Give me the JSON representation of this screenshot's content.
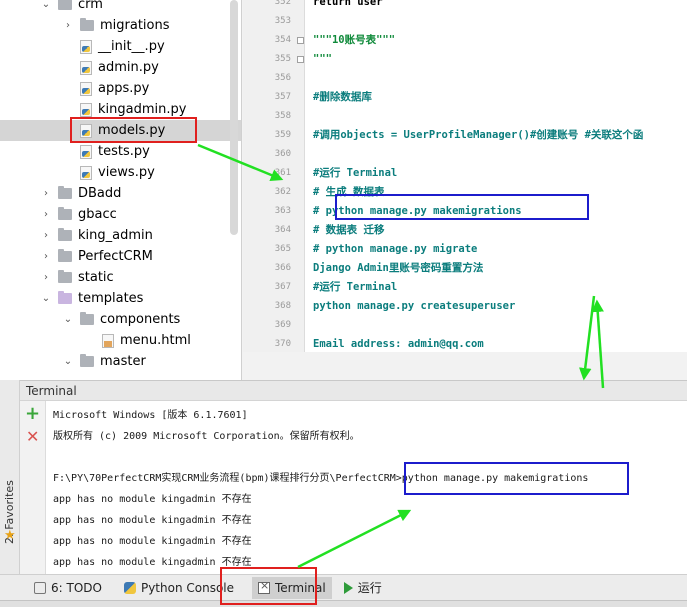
{
  "tree": {
    "items": [
      {
        "label": "crm",
        "kind": "folder",
        "arrow": "⌄",
        "level": 1
      },
      {
        "label": "migrations",
        "kind": "folder",
        "arrow": "›",
        "level": 2
      },
      {
        "label": "__init__.py",
        "kind": "py",
        "arrow": "",
        "level": 2
      },
      {
        "label": "admin.py",
        "kind": "py",
        "arrow": "",
        "level": 2
      },
      {
        "label": "apps.py",
        "kind": "py",
        "arrow": "",
        "level": 2
      },
      {
        "label": "kingadmin.py",
        "kind": "py",
        "arrow": "",
        "level": 2
      },
      {
        "label": "models.py",
        "kind": "py",
        "arrow": "",
        "level": 2,
        "selected": true
      },
      {
        "label": "tests.py",
        "kind": "py",
        "arrow": "",
        "level": 2
      },
      {
        "label": "views.py",
        "kind": "py",
        "arrow": "",
        "level": 2
      },
      {
        "label": "DBadd",
        "kind": "folder",
        "arrow": "›",
        "level": 1
      },
      {
        "label": "gbacc",
        "kind": "folder",
        "arrow": "›",
        "level": 1
      },
      {
        "label": "king_admin",
        "kind": "folder",
        "arrow": "›",
        "level": 1
      },
      {
        "label": "PerfectCRM",
        "kind": "folder",
        "arrow": "›",
        "level": 1
      },
      {
        "label": "static",
        "kind": "folder",
        "arrow": "›",
        "level": 1
      },
      {
        "label": "templates",
        "kind": "folder-purple",
        "arrow": "⌄",
        "level": 1
      },
      {
        "label": "components",
        "kind": "folder",
        "arrow": "⌄",
        "level": 2
      },
      {
        "label": "menu.html",
        "kind": "html",
        "arrow": "",
        "level": 3
      },
      {
        "label": "master",
        "kind": "folder",
        "arrow": "⌄",
        "level": 2
      }
    ]
  },
  "editor": {
    "lines": [
      {
        "num": "352",
        "text": "    return user",
        "style": "plain"
      },
      {
        "num": "353",
        "text": "",
        "style": "plain"
      },
      {
        "num": "354",
        "text": "\"\"\"10账号表\"\"\"",
        "style": "doc"
      },
      {
        "num": "355",
        "text": "\"\"\"",
        "style": "doc"
      },
      {
        "num": "356",
        "text": "",
        "style": "plain"
      },
      {
        "num": "357",
        "text": "#删除数据库",
        "style": "comment"
      },
      {
        "num": "358",
        "text": "",
        "style": "plain"
      },
      {
        "num": "359",
        "text": "#调用objects = UserProfileManager()#创建账号 #关联这个函",
        "style": "comment"
      },
      {
        "num": "360",
        "text": "",
        "style": "plain"
      },
      {
        "num": "361",
        "text": "#运行 Terminal",
        "style": "comment"
      },
      {
        "num": "362",
        "text": "#    生成 数据表",
        "style": "comment"
      },
      {
        "num": "363",
        "text": "#    python manage.py makemigrations",
        "style": "comment"
      },
      {
        "num": "364",
        "text": "#   数据表 迁移",
        "style": "comment"
      },
      {
        "num": "365",
        "text": "#    python manage.py migrate",
        "style": "comment"
      },
      {
        "num": "366",
        "text": "Django Admin里账号密码重置方法",
        "style": "comment"
      },
      {
        "num": "367",
        "text": "#运行 Terminal",
        "style": "comment"
      },
      {
        "num": "368",
        "text": "python manage.py createsuperuser",
        "style": "comment"
      },
      {
        "num": "369",
        "text": "",
        "style": "plain"
      },
      {
        "num": "370",
        "text": "Email address:          admin@qq.com",
        "style": "comment"
      }
    ]
  },
  "terminal": {
    "title": "Terminal",
    "lines": [
      "Microsoft Windows [版本 6.1.7601]",
      "版权所有 (c) 2009 Microsoft Corporation。保留所有权利。",
      "",
      "F:\\PY\\70PerfectCRM实现CRM业务流程(bpm)课程排行分页\\PerfectCRM>python manage.py makemigrations",
      "app has no module kingadmin 不存在",
      "app has no module kingadmin 不存在",
      "app has no module kingadmin 不存在",
      "app has no module kingadmin 不存在"
    ]
  },
  "side": {
    "favorites": "2: Favorites"
  },
  "toolbar": {
    "tabs": [
      {
        "label": "6: TODO",
        "icon": "todo-icon"
      },
      {
        "label": "Python Console",
        "icon": "python-console-icon"
      },
      {
        "label": "Terminal",
        "icon": "terminal-icon",
        "active": true
      },
      {
        "label": "运行",
        "icon": "run-icon"
      }
    ]
  },
  "colors": {
    "annotation_red": "#e0201e",
    "annotation_blue": "#1c1ccc",
    "annotation_arrow": "#22e022"
  }
}
